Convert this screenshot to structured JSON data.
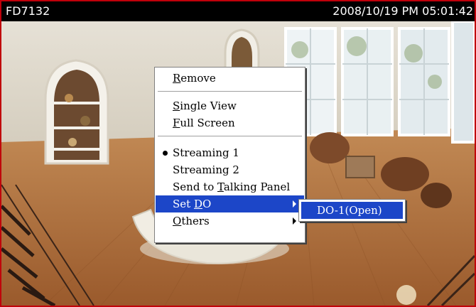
{
  "camera": {
    "name": "FD7132",
    "timestamp": "2008/10/19 PM 05:01:42"
  },
  "context_menu": {
    "remove": "Remove",
    "single_view": "Single View",
    "full_screen": "Full Screen",
    "streaming_1": "Streaming 1",
    "streaming_2": "Streaming 2",
    "send_to_talking_panel": "Send to Talking Panel",
    "set_do": "Set DO",
    "others": "Others",
    "selected_stream": "Streaming 1"
  },
  "submenu": {
    "do_1": "DO-1(Open)"
  },
  "colors": {
    "frame_border": "#c0000a",
    "highlight": "#1c46c8",
    "title_bar": "#000000"
  }
}
